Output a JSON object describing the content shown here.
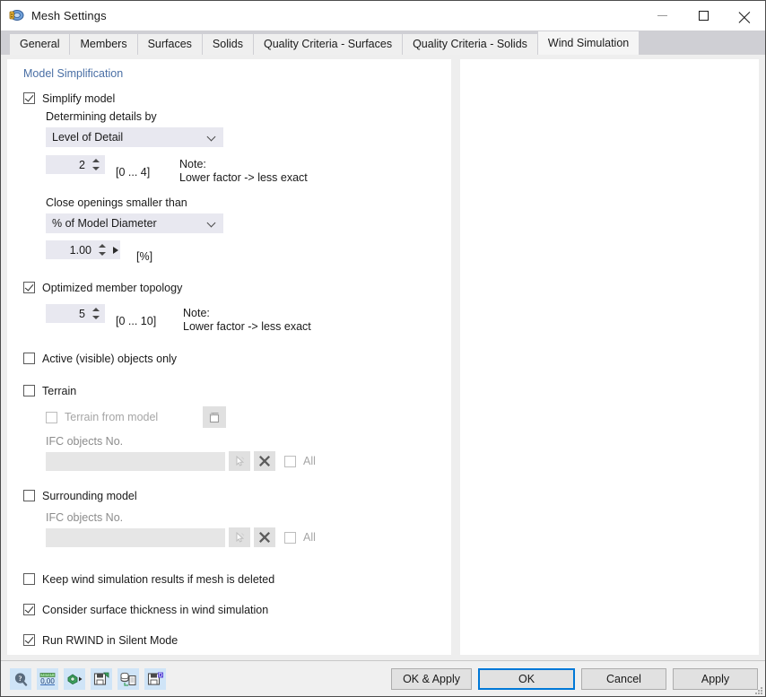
{
  "window": {
    "title": "Mesh Settings",
    "icon": "mesh-settings-icon",
    "minimize_label": "Minimize",
    "maximize_label": "Maximize",
    "close_label": "Close"
  },
  "tabs": [
    {
      "label": "General",
      "active": false
    },
    {
      "label": "Members",
      "active": false
    },
    {
      "label": "Surfaces",
      "active": false
    },
    {
      "label": "Solids",
      "active": false
    },
    {
      "label": "Quality Criteria - Surfaces",
      "active": false
    },
    {
      "label": "Quality Criteria - Solids",
      "active": false
    },
    {
      "label": "Wind Simulation",
      "active": true
    }
  ],
  "form": {
    "section_title": "Model Simplification",
    "simplify_model": {
      "label": "Simplify model",
      "checked": true
    },
    "determining_details_by": {
      "label": "Determining details by",
      "value": "Level of Detail"
    },
    "level_of_detail": {
      "value": "2",
      "range": "[0 ... 4]",
      "note_line1": "Note:",
      "note_line2": "Lower factor -> less exact"
    },
    "close_openings": {
      "label": "Close openings smaller than",
      "value": "% of Model Diameter"
    },
    "close_openings_value": {
      "value": "1.00",
      "unit": "[%]"
    },
    "optimized_member_topology": {
      "label": "Optimized member topology",
      "checked": true,
      "value": "5",
      "range": "[0 ... 10]",
      "note_line1": "Note:",
      "note_line2": "Lower factor -> less exact"
    },
    "active_objects_only": {
      "label": "Active (visible) objects only",
      "checked": false
    },
    "terrain": {
      "label": "Terrain",
      "checked": false,
      "from_model_label": "Terrain from model",
      "from_model_checked": false,
      "ifc_label": "IFC objects No.",
      "ifc_value": "",
      "all_label": "All",
      "all_checked": false
    },
    "surrounding_model": {
      "label": "Surrounding model",
      "checked": false,
      "ifc_label": "IFC objects No.",
      "ifc_value": "",
      "all_label": "All",
      "all_checked": false
    },
    "keep_results": {
      "label": "Keep wind simulation results if mesh is deleted",
      "checked": false
    },
    "consider_thickness": {
      "label": "Consider surface thickness in wind simulation",
      "checked": true
    },
    "run_silent": {
      "label": "Run RWIND in Silent Mode",
      "checked": true
    }
  },
  "footer": {
    "tools": [
      {
        "name": "help-icon"
      },
      {
        "name": "units-icon",
        "label": "0,00"
      },
      {
        "name": "settings-run-icon"
      },
      {
        "name": "save-settings-icon"
      },
      {
        "name": "import-settings-icon"
      },
      {
        "name": "save-default-icon",
        "badge": "D"
      }
    ],
    "buttons": [
      {
        "label": "OK & Apply",
        "default": false
      },
      {
        "label": "OK",
        "default": true
      },
      {
        "label": "Cancel",
        "default": false
      },
      {
        "label": "Apply",
        "default": false
      }
    ]
  },
  "colors": {
    "accent": "#4a6fa5",
    "focus": "#0078d7",
    "tool_bg": "#cfe4f7",
    "field_bg": "#e8e8f0"
  }
}
